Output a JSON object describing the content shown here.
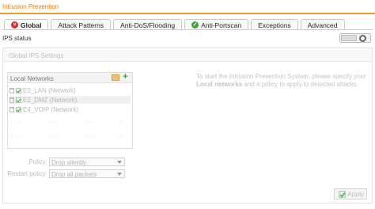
{
  "window": {
    "title": "Intrusion Prevention"
  },
  "tabs": [
    {
      "label": "Global",
      "icon": "status-red-icon",
      "active": true
    },
    {
      "label": "Attack Patterns"
    },
    {
      "label": "Anti-DoS/Flooding"
    },
    {
      "label": "Anti-Portscan",
      "icon": "status-green-icon"
    },
    {
      "label": "Exceptions"
    },
    {
      "label": "Advanced"
    }
  ],
  "ips_status": {
    "label": "IPS status",
    "enabled": false
  },
  "global_settings": {
    "header": "Global IPS Settings",
    "local_networks": {
      "title": "Local Networks",
      "items": [
        {
          "label": "E0_LAN (Network)"
        },
        {
          "label": "E2_DMZ (Network)"
        },
        {
          "label": "E4_VOIP (Network)"
        }
      ]
    },
    "hint": {
      "line1": "To start the Intrusion Prevention System, please specify your",
      "bold": "Local networks",
      "line2": " and a policy to apply to detected attacks."
    },
    "policy": {
      "label": "Policy:",
      "value": "Drop silently"
    },
    "restart_policy": {
      "label": "Restart policy:",
      "value": "Drop all packets"
    }
  },
  "apply_button": {
    "label": "Apply"
  },
  "colors": {
    "accent": "#f0a030",
    "title": "#e07a10",
    "error": "#d2312b",
    "ok": "#3ea33a"
  }
}
